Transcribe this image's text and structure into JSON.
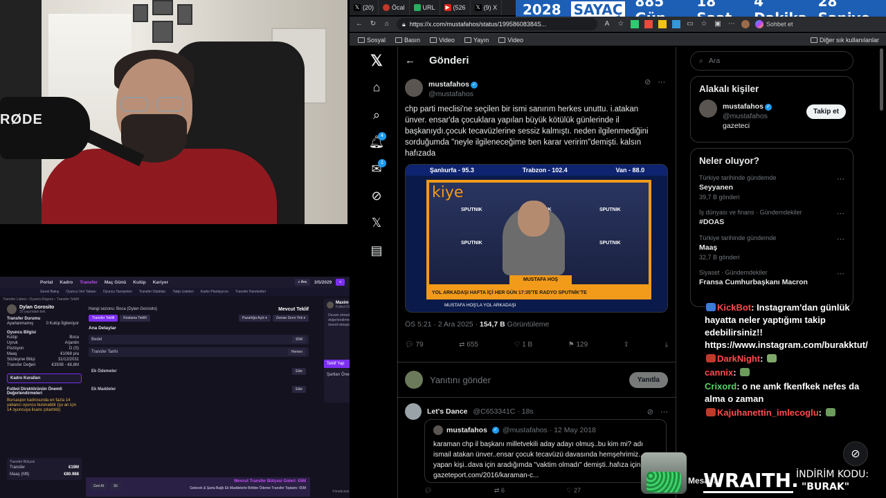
{
  "browser": {
    "tabs": [
      {
        "label": "(20)",
        "icon": "x-icon"
      },
      {
        "label": "Öcal",
        "icon": "ocal-icon"
      },
      {
        "label": "URL",
        "icon": "url-icon"
      },
      {
        "label": "(526",
        "icon": "yt-icon"
      },
      {
        "label": "(9) X",
        "icon": "x-icon"
      }
    ],
    "url": "https://x.com/mustafahos/status/19958608384S...",
    "bookmarks": [
      "Sosyal",
      "Basın",
      "Video",
      "Yayın",
      "Video"
    ],
    "other_bookmarks": "Diğer sık kullanılanlar",
    "chat_button": "Sohbet et"
  },
  "counter": {
    "year": "2028",
    "label": "SAYAÇ",
    "days": "885 Gün",
    "hours": "18 Saat",
    "minutes": "4 Dakika",
    "seconds": "28 Saniye"
  },
  "x": {
    "header": "Gönderi",
    "notif_badge": "4",
    "msg_badge": "1",
    "post": {
      "name": "mustafahos",
      "handle": "@mustafahos",
      "text": "chp parti meclisi'ne seçilen bir ismi sanırım herkes unuttu. i.atakan ünver. ensar'da çocuklara yapılan büyük kötülük günlerinde il başkanıydı.çocuk tecavüzlerine sessiz kalmıştı.  neden ilgilenmediğini sorduğumda \"neyle ilgileneceğime ben karar veririm\"demişti. kalsın hafızada",
      "time": "ÖS 5:21 · 2 Ara 2025 · ",
      "views": "154,7 B",
      "views_label": " Görüntüleme",
      "replies": "79",
      "reposts": "655",
      "likes": "1 B",
      "bookmarks": "129"
    },
    "media": {
      "ticker": [
        "Şanlıurfa - 95.3",
        "Trabzon - 102.4",
        "Van - 88.0"
      ],
      "logo": "kiye",
      "sputnik": "SPUTNIK",
      "nameplate": "MUSTAFA HOŞ",
      "banner": "YOL ARKADAŞI HAFTA İÇİ HER GÜN 17:35'TE RADYO SPUTNİK'TE",
      "subtitle": "MUSTAFA HOŞ'LA YOL ARKADAŞI"
    },
    "reply_placeholder": "Yanıtını gönder",
    "reply_button": "Yanıtla",
    "reply": {
      "name": "Let's Dance",
      "handle": "@C653341C · 18s",
      "quote_name": "mustafahos",
      "quote_handle": "@mustafahos · 12 May 2018",
      "quote_text": "karaman chp il başkanı milletvekili aday adayı olmuş..bu kim mi? adı ismail atakan ünver..ensar çocuk tecavüzü davasında hemşehrimiz.... yapan kişi..dava için aradığımda \"vaktim olmadı\" demişti..hafıza için... gazeteport.com/2016/karaman-c...",
      "reposts": "6",
      "likes": "27",
      "views": "3 B"
    },
    "search_placeholder": "Ara",
    "related": {
      "title": "Alakalı kişiler",
      "name": "mustafahos",
      "handle": "@mustafahos",
      "bio": "gazeteci",
      "follow": "Takip et"
    },
    "trends": {
      "title": "Neler oluyor?",
      "items": [
        {
          "ctx": "Türkiye tarihinde gündemde",
          "title": "Seyyanen",
          "count": "39,7 B gönderi"
        },
        {
          "ctx": "İş dünyası ve finans · Gündemdekiler",
          "title": "#DOAS",
          "count": ""
        },
        {
          "ctx": "Türkiye tarihinde gündemde",
          "title": "Maaş",
          "count": "32,7 B gönderi"
        },
        {
          "ctx": "Siyaset · Gündemdekiler",
          "title": "Fransa Cumhurbaşkanı Macron",
          "count": ""
        }
      ]
    }
  },
  "chat": [
    {
      "user": "KickBot",
      "color": "#ff4b4b",
      "text": ": Instagram'dan günlük hayatta neler yaptığımı takip edebilirsiniz!! https://www.instagram.com/burakktut/"
    },
    {
      "user": "DarkNight",
      "color": "#ff4b4b",
      "text": ": "
    },
    {
      "user": "cannix",
      "color": "#ff4b4b",
      "text": ": "
    },
    {
      "user": "Crixord",
      "color": "#5bd16a",
      "text": ": o ne amk fkenfkek nefes da alma o zaman"
    },
    {
      "user": "Kajuhanettin_imlecoglu",
      "color": "#ff4b4b",
      "text": ": "
    }
  ],
  "promo": {
    "brand": "WRAITH.",
    "code_label": "İNDİRİM KODU:",
    "code": "\"BURAK\""
  },
  "messages_bar": "Mesajlar",
  "game": {
    "nav": [
      "Portal",
      "Kadro",
      "Transfer",
      "Maç Günü",
      "Kulüp",
      "Kariyer"
    ],
    "subnav": [
      "Genel Bakış",
      "Oyuncu Veri Tabanı",
      "Oyuncu Tavsiyeleri",
      "Transfer Odakları",
      "Takip Listeleri",
      "Kadro Planlayıcısı",
      "Transfer Hareketleri"
    ],
    "crumbs": "Transfer Listesi › Oyuncu Raporu › Transfer Teklifi",
    "date": "3/5/2029",
    "player": "Dylan Gorosito",
    "player_age": "33 yaşındaki bek",
    "transfer_status": "Transfer Durumu",
    "status_value": "Ayarlanmamış",
    "player_info": "Oyuncu Bilgisi",
    "info_rows": [
      {
        "k": "Kulüp",
        "v": "Boca"
      },
      {
        "k": "Uyruk",
        "v": "Arjantin"
      },
      {
        "k": "Pozisyon",
        "v": "D (S)"
      },
      {
        "k": "Maaş",
        "v": "€1068 p/a"
      },
      {
        "k": "Sözleşme Bitişi",
        "v": "31/12/2031"
      },
      {
        "k": "Transfer Değeri",
        "v": "€350B - €6,8M"
      }
    ],
    "squad_rules": "Kadro Kuralları",
    "director_note": "Futbol Direktörünün Önemli Değerlendirmeleri",
    "warning": "Bursaspor kadrosunda en fazla 14 yabancı oyuncu bulunabilir (şu an için 14 oyuncuya lisans çıkartıldı)",
    "budget_title": "Transfer Bütçesi",
    "transfer_label": "Transfer",
    "transfer_value": "€19M",
    "wage_label": "Maaş (hftl)",
    "wage_value": "€80.988",
    "negotiating": "Hangi sezonu: Boca (Dylan Gorosito)",
    "mevcut_teklif": "Mevcut Teklif",
    "tabs": [
      "Transfer Teklifi",
      "Kiralama Teklifi"
    ],
    "sec_ana": "Ana Detaylar",
    "bedel": "Bedel",
    "bedel_value": "€6M",
    "transfer_tarihi": "Transfer Tarihi",
    "hemen": "Hemen",
    "ek_odemeler": "Ek Ödemeler",
    "ek_maddeler": "Ek Maddeler",
    "ekle": "Ekle",
    "budget_footer": "Mevcut Transfer Bütçesi Gideri: €5M",
    "budget_footer2": "Gelecek & Şarta Bağlı Ek Maddelerle Birlikte Ödeme Transfer Toplamı: €5M",
    "geri_al": "Geri Al",
    "sil": "Sil",
    "right_name": "Maxim Saverio",
    "right_role": "Futbol Direktörü",
    "right_text": "Devam etmeden önce değerlendirmemiz gereken bazı önemli detaylar",
    "teklif_yap": "Teklif Yap",
    "sartlari_oner": "Şartları Öner",
    "right_footer": "Yöneticinin Kuruluş Eylemleri"
  }
}
